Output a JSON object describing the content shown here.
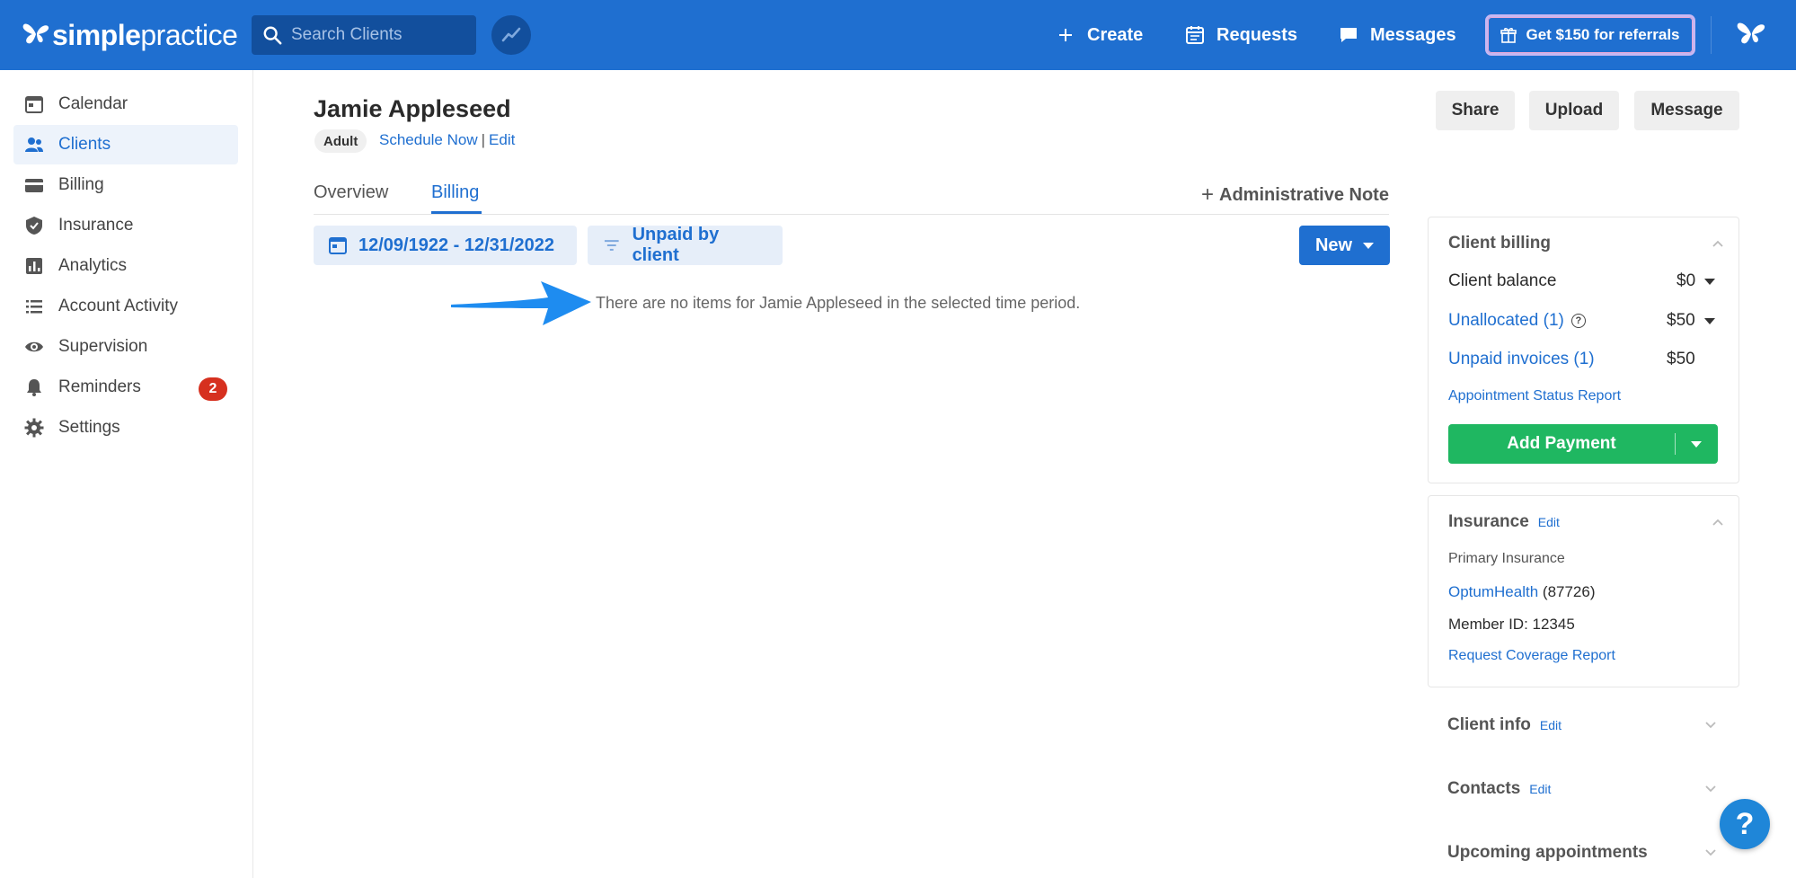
{
  "brand": {
    "name_bold": "simple",
    "name_light": "practice"
  },
  "topbar": {
    "search_placeholder": "Search Clients",
    "create_label": "Create",
    "requests_label": "Requests",
    "messages_label": "Messages",
    "referral_label": "Get $150 for referrals"
  },
  "sidebar": {
    "items": [
      {
        "label": "Calendar",
        "icon": "calendar-icon"
      },
      {
        "label": "Clients",
        "icon": "clients-icon",
        "active": true
      },
      {
        "label": "Billing",
        "icon": "billing-card-icon"
      },
      {
        "label": "Insurance",
        "icon": "shield-icon"
      },
      {
        "label": "Analytics",
        "icon": "bar-chart-icon"
      },
      {
        "label": "Account Activity",
        "icon": "list-icon"
      },
      {
        "label": "Supervision",
        "icon": "eye-icon"
      },
      {
        "label": "Reminders",
        "icon": "bell-icon",
        "badge": "2"
      },
      {
        "label": "Settings",
        "icon": "gear-icon"
      }
    ]
  },
  "client": {
    "name": "Jamie Appleseed",
    "age_tag": "Adult",
    "schedule_link": "Schedule Now",
    "separator": "|",
    "edit_link": "Edit"
  },
  "actions": {
    "share": "Share",
    "upload": "Upload",
    "message": "Message"
  },
  "tabs": {
    "overview": "Overview",
    "billing": "Billing",
    "admin_note": "Administrative Note"
  },
  "billing_filters": {
    "date_range": "12/09/1922 - 12/31/2022",
    "filter": "Unpaid by client",
    "new_button": "New"
  },
  "empty_message": "There are no items for Jamie Appleseed in the selected time period.",
  "client_billing": {
    "title": "Client billing",
    "balance_label": "Client balance",
    "balance_value": "$0",
    "unallocated_label": "Unallocated (1)",
    "unallocated_value": "$50",
    "unpaid_label": "Unpaid invoices (1)",
    "unpaid_value": "$50",
    "status_report": "Appointment Status Report",
    "add_payment": "Add Payment"
  },
  "insurance": {
    "title": "Insurance",
    "edit": "Edit",
    "primary_label": "Primary Insurance",
    "provider": "OptumHealth",
    "provider_code": "(87726)",
    "member_id": "Member ID: 12345",
    "coverage_report": "Request Coverage Report"
  },
  "collapsed_sections": {
    "client_info": "Client info",
    "client_info_edit": "Edit",
    "contacts": "Contacts",
    "contacts_edit": "Edit",
    "upcoming": "Upcoming appointments"
  },
  "help_label": "?",
  "colors": {
    "primary": "#1f6fd0",
    "success": "#1fb761",
    "badge": "#d6301f"
  }
}
